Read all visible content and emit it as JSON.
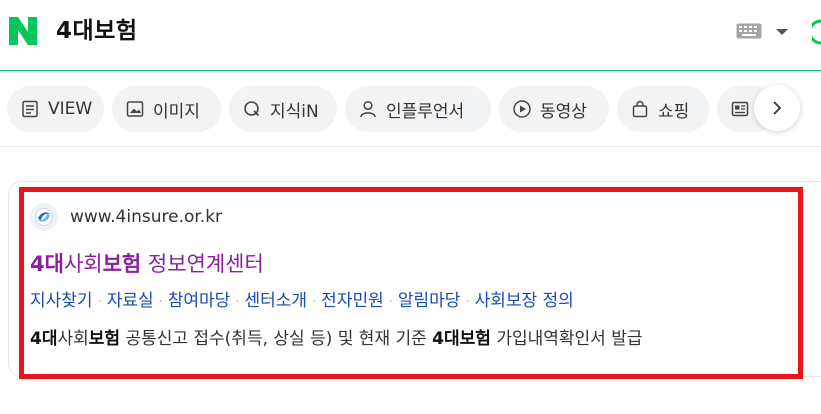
{
  "header": {
    "logo_letter": "N",
    "query": "4대보험",
    "brand_color": "#03c75a"
  },
  "tabs": [
    {
      "label": "VIEW",
      "icon": "document-icon"
    },
    {
      "label": "이미지",
      "icon": "image-icon"
    },
    {
      "label": "지식iN",
      "icon": "q-icon"
    },
    {
      "label": "인플루언서",
      "icon": "person-icon"
    },
    {
      "label": "동영상",
      "icon": "play-icon"
    },
    {
      "label": "쇼핑",
      "icon": "shopping-bag-icon"
    },
    {
      "label": "",
      "icon": "news-icon"
    }
  ],
  "result": {
    "url": "www.4insure.or.kr",
    "title_parts": [
      "4대",
      "사회",
      "보험",
      " 정보연계센터"
    ],
    "sublinks": [
      "지사찾기",
      "자료실",
      "참여마당",
      "센터소개",
      "전자민원",
      "알림마당",
      "사회보장 정의"
    ],
    "description_parts": [
      "4대",
      "사회",
      "보험",
      " 공통신고 접수(취득, 상실 등) 및 현재 기준 ",
      "4대보험",
      " 가입내역확인서 발급"
    ],
    "title_color": "#8b1fa0",
    "link_color": "#1c4ab6",
    "highlight_color": "#e8141e"
  }
}
